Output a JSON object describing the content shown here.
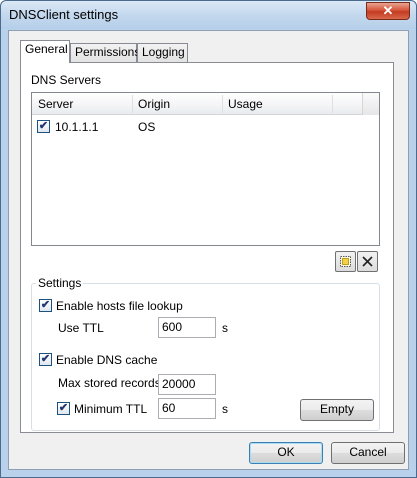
{
  "window": {
    "title": "DNSClient settings",
    "close_glyph": "✕"
  },
  "tabs": [
    {
      "label": "General",
      "active": true
    },
    {
      "label": "Permissions",
      "active": false
    },
    {
      "label": "Logging",
      "active": false
    }
  ],
  "dns_servers": {
    "section_label": "DNS Servers",
    "columns": [
      "Server",
      "Origin",
      "Usage"
    ],
    "rows": [
      {
        "checked": true,
        "server": "10.1.1.1",
        "origin": "OS",
        "usage": ""
      }
    ],
    "add_icon": "add-server-icon",
    "remove_icon": "remove-server-icon"
  },
  "settings": {
    "group_label": "Settings",
    "hosts_lookup": {
      "label": "Enable hosts file lookup",
      "checked": true
    },
    "use_ttl": {
      "label": "Use TTL",
      "value": "600",
      "unit": "s"
    },
    "dns_cache": {
      "label": "Enable DNS cache",
      "checked": true
    },
    "max_records": {
      "label": "Max stored records",
      "value": "20000"
    },
    "min_ttl": {
      "label": "Minimum TTL",
      "checked": true,
      "value": "60",
      "unit": "s"
    },
    "empty_button": "Empty"
  },
  "buttons": {
    "ok": "OK",
    "cancel": "Cancel"
  },
  "check_glyph": "✔",
  "colors": {
    "titlebar": "#c3d8ee",
    "close_button": "#c33b21",
    "default_button_border": "#3c7fb1"
  }
}
